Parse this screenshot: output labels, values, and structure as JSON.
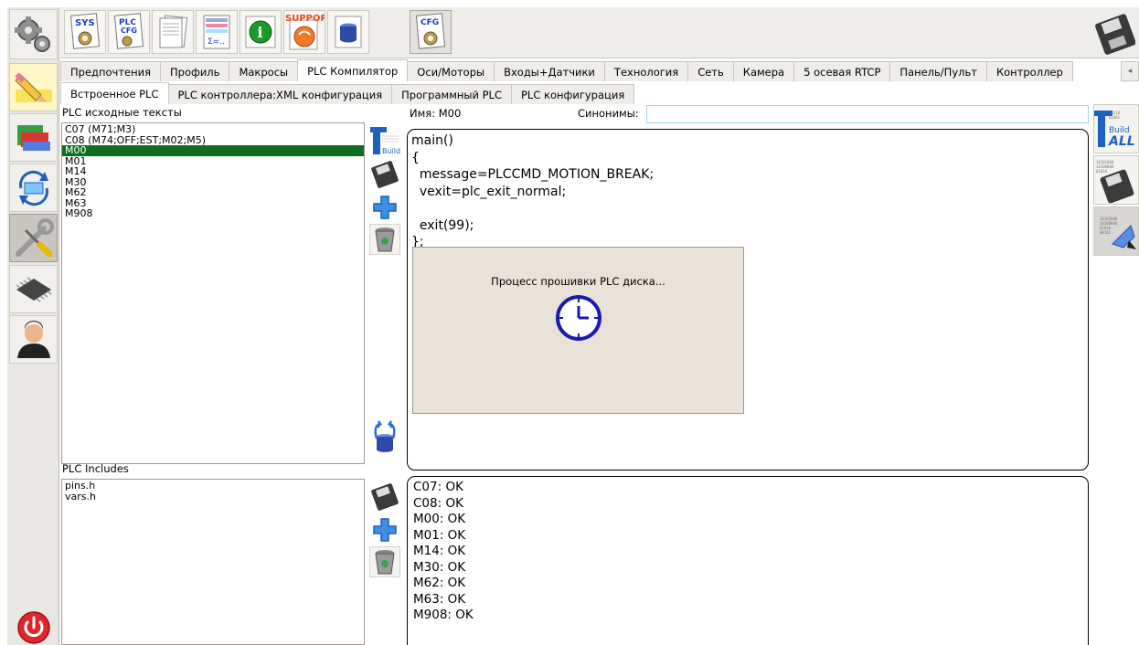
{
  "toolbar": {
    "buttons": [
      {
        "name": "sys-config-button",
        "label": "SYS",
        "icon": "sys-gear-icon"
      },
      {
        "name": "plc-config-button",
        "label": "PLC CFG",
        "icon": "plc-cfg-icon"
      },
      {
        "name": "documents-button",
        "label": "",
        "icon": "documents-icon"
      },
      {
        "name": "formula-editor-button",
        "label": "Σ=...",
        "icon": "formula-icon"
      },
      {
        "name": "info-button",
        "label": "i",
        "icon": "info-icon"
      },
      {
        "name": "support-button",
        "label": "SUPPORT",
        "icon": "support-icon"
      },
      {
        "name": "database-button",
        "label": "",
        "icon": "database-icon"
      },
      {
        "name": "cfg-button",
        "label": "CFG",
        "icon": "cfg-gear-icon"
      }
    ]
  },
  "tabs_main": [
    {
      "label": "Предпочтения"
    },
    {
      "label": "Профиль"
    },
    {
      "label": "Макросы"
    },
    {
      "label": "PLC Компилятор",
      "active": true
    },
    {
      "label": "Оси/Моторы"
    },
    {
      "label": "Входы+Датчики"
    },
    {
      "label": "Технология"
    },
    {
      "label": "Сеть"
    },
    {
      "label": "Камера"
    },
    {
      "label": "5 осевая RTCP"
    },
    {
      "label": "Панель/Пульт"
    },
    {
      "label": "Контроллер"
    }
  ],
  "tabs_sub": [
    {
      "label": "Встроенное PLC",
      "active": true
    },
    {
      "label": "PLC контроллера:XML конфигурация"
    },
    {
      "label": "Программный PLC"
    },
    {
      "label": "PLC конфигурация"
    }
  ],
  "plc_sources": {
    "title": "PLC исходные тексты",
    "items": [
      "C07 (M71;M3)",
      "C08 (M74;OFF;EST;M02;M5)",
      "M00",
      "M01",
      "M14",
      "M30",
      "M62",
      "M63",
      "M908"
    ],
    "selected_index": 2
  },
  "plc_includes": {
    "title": "PLC Includes",
    "items": [
      "pins.h",
      "vars.h"
    ]
  },
  "name_label": "Имя:",
  "name_value": "M00",
  "synonyms_label": "Синонимы:",
  "synonyms_value": "",
  "editor_code": "main()\n{\n  message=PLCCMD_MOTION_BREAK;\n  vexit=plc_exit_normal;\n\n  exit(99);\n};",
  "progress_message": "Процесс прошивки PLC диска...",
  "output_lines": "C07: OK\nC08: OK\nM00: OK\nM01: OK\nM14: OK\nM30: OK\nM62: OK\nM63: OK\nM908: OK",
  "build_all_label": "ALL",
  "colors": {
    "selected_row": "#0f6e1b",
    "field_border": "#9fd6e6",
    "progress_bg": "#e8e2d8",
    "power_red": "#e0262b"
  }
}
